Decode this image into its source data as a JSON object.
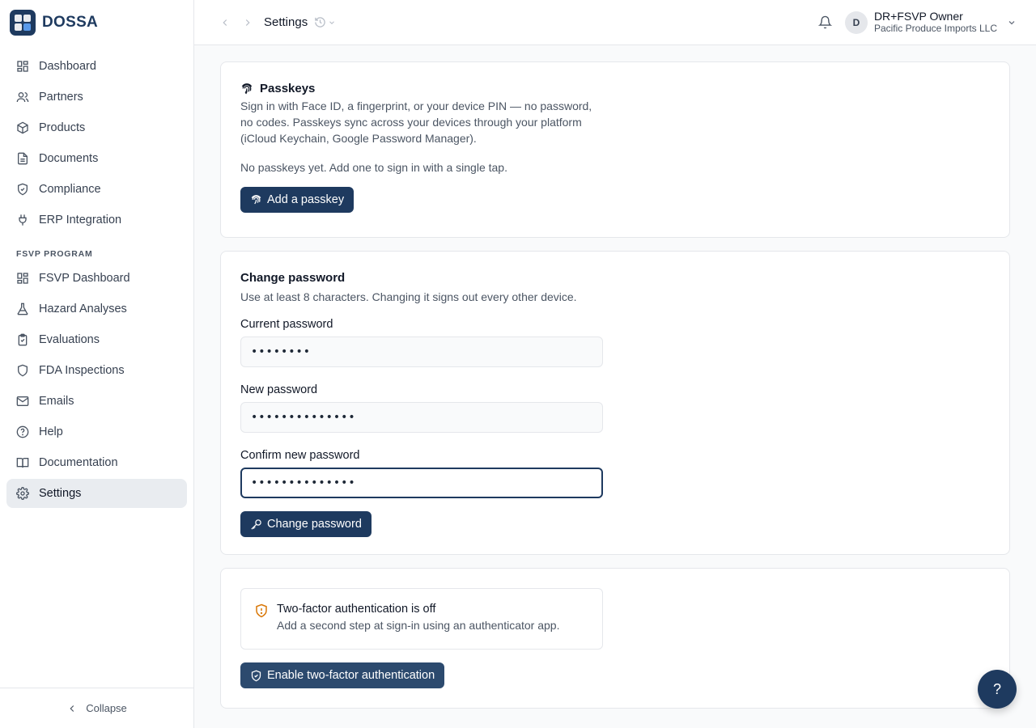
{
  "brand": {
    "name": "DOSSA"
  },
  "sidebar": {
    "items": [
      {
        "label": "Dashboard",
        "icon": "dashboard-icon"
      },
      {
        "label": "Partners",
        "icon": "users-icon"
      },
      {
        "label": "Products",
        "icon": "box-icon"
      },
      {
        "label": "Documents",
        "icon": "document-icon"
      },
      {
        "label": "Compliance",
        "icon": "shield-check-icon"
      },
      {
        "label": "ERP Integration",
        "icon": "plug-icon"
      }
    ],
    "section_label": "FSVP PROGRAM",
    "program_items": [
      {
        "label": "FSVP Dashboard",
        "icon": "dashboard-icon"
      },
      {
        "label": "Hazard Analyses",
        "icon": "flask-icon"
      },
      {
        "label": "Evaluations",
        "icon": "clipboard-icon"
      },
      {
        "label": "FDA Inspections",
        "icon": "shield-icon"
      },
      {
        "label": "Emails",
        "icon": "mail-icon"
      },
      {
        "label": "Help",
        "icon": "help-circle-icon"
      },
      {
        "label": "Documentation",
        "icon": "book-icon"
      },
      {
        "label": "Settings",
        "icon": "gear-icon",
        "active": true
      }
    ],
    "collapse_label": "Collapse"
  },
  "topbar": {
    "title": "Settings",
    "user": {
      "initial": "D",
      "name": "DR+FSVP Owner",
      "org": "Pacific Produce Imports LLC"
    }
  },
  "passkeys": {
    "title": "Passkeys",
    "description": "Sign in with Face ID, a fingerprint, or your device PIN — no password, no codes. Passkeys sync across your devices through your platform (iCloud Keychain, Google Password Manager).",
    "empty_note": "No passkeys yet. Add one to sign in with a single tap.",
    "button_label": "Add a passkey"
  },
  "password": {
    "title": "Change password",
    "description": "Use at least 8 characters. Changing it signs out every other device.",
    "current_label": "Current password",
    "current_value": "••••••••",
    "new_label": "New password",
    "new_value": "••••••••••••••",
    "confirm_label": "Confirm new password",
    "confirm_value": "••••••••••••••",
    "button_label": "Change password"
  },
  "two_factor": {
    "alert_title": "Two-factor authentication is off",
    "alert_description": "Add a second step at sign-in using an authenticator app.",
    "button_label": "Enable two-factor authentication"
  },
  "help_fab": {
    "label": "?"
  },
  "colors": {
    "primary": "#1e3a5f",
    "warning": "#d97706",
    "active_bg": "#e9ecf0"
  }
}
